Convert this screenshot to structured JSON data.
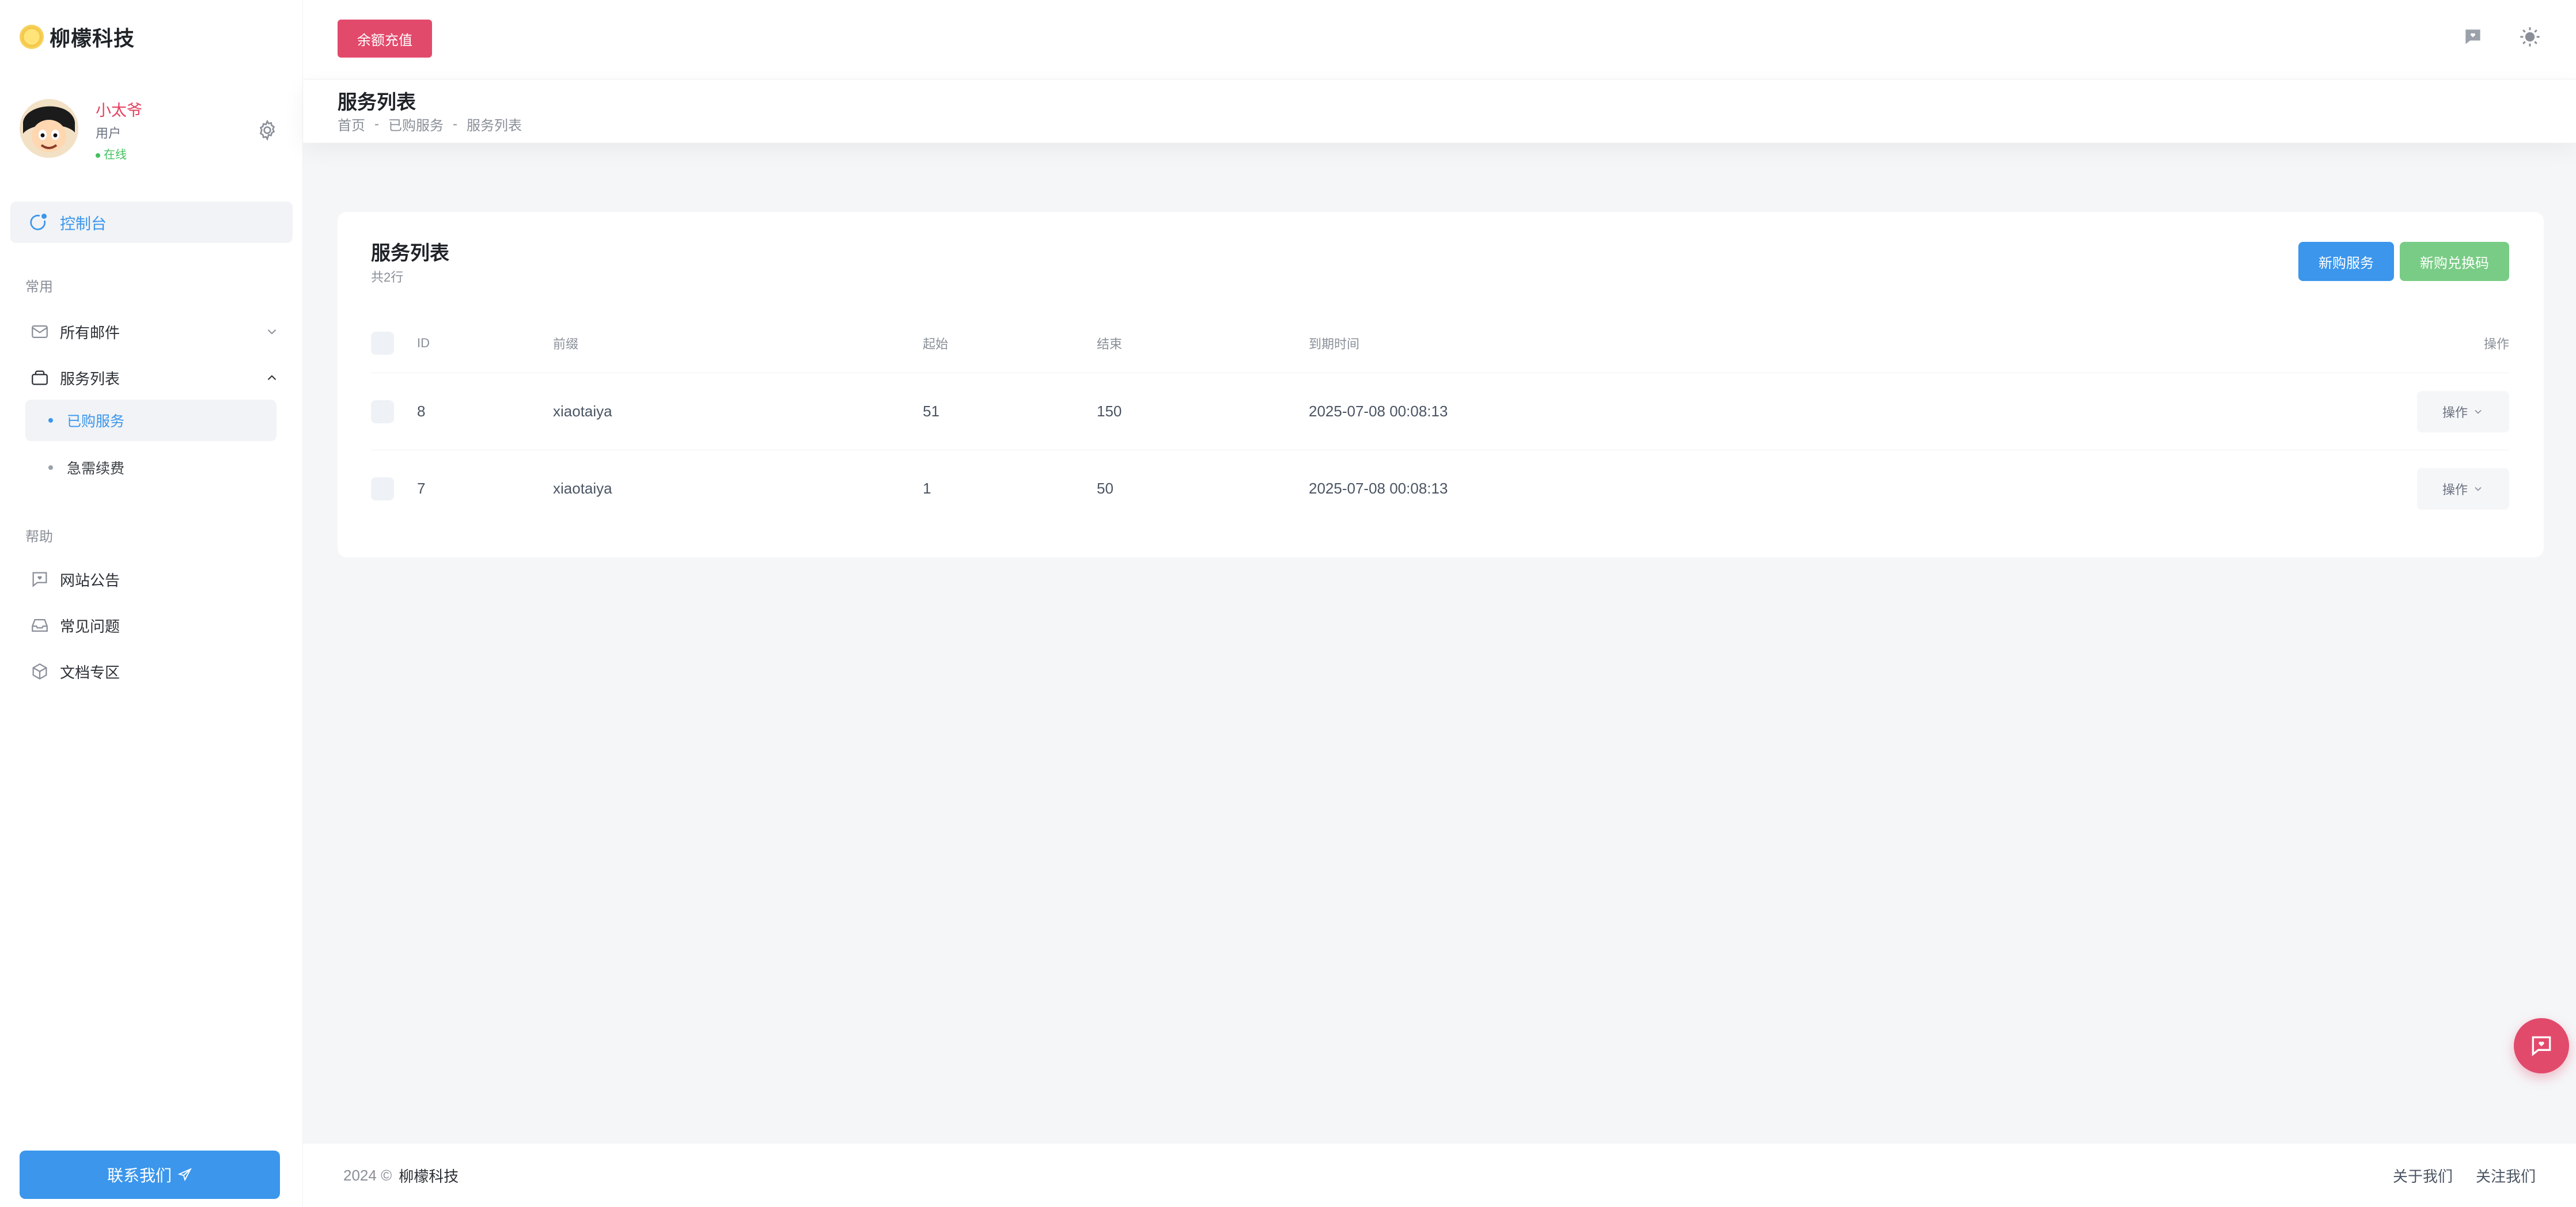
{
  "brand": {
    "name": "柳檬科技"
  },
  "profile": {
    "name": "小太爷",
    "role": "用户",
    "status": "在线"
  },
  "nav": {
    "dashboard": "控制台",
    "section_common": "常用",
    "all_mail": "所有邮件",
    "service_list": "服务列表",
    "sub_purchased": "已购服务",
    "sub_renew": "急需续费",
    "section_help": "帮助",
    "announcement": "网站公告",
    "faq": "常见问题",
    "docs": "文档专区",
    "contact": "联系我们"
  },
  "topbar": {
    "recharge": "余额充值"
  },
  "breadcrumb": {
    "title": "服务列表",
    "home": "首页",
    "sep": "-",
    "level1": "已购服务",
    "level2": "服务列表"
  },
  "card": {
    "title": "服务列表",
    "subtitle": "共2行",
    "btn_new": "新购服务",
    "btn_code": "新购兑换码"
  },
  "table": {
    "headers": {
      "id": "ID",
      "prefix": "前缀",
      "start": "起始",
      "end": "结束",
      "expire": "到期时间",
      "op": "操作"
    },
    "rows": [
      {
        "id": "8",
        "prefix": "xiaotaiya",
        "start": "51",
        "end": "150",
        "expire": "2025-07-08 00:08:13",
        "op": "操作"
      },
      {
        "id": "7",
        "prefix": "xiaotaiya",
        "start": "1",
        "end": "50",
        "expire": "2025-07-08 00:08:13",
        "op": "操作"
      }
    ]
  },
  "footer": {
    "copyright": "2024 ©",
    "brand": "柳檬科技",
    "about": "关于我们",
    "follow": "关注我们"
  },
  "colors": {
    "accent": "#3b96ec",
    "success": "#79cc85",
    "danger": "#e24a6b"
  }
}
